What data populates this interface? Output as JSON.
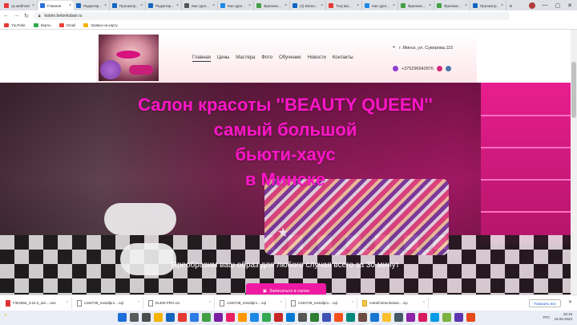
{
  "browser": {
    "tabs": [
      {
        "label": "cp.webhost...",
        "color": "#e53935",
        "active": false
      },
      {
        "label": "Главная",
        "color": "#2f6fd6",
        "active": true
      },
      {
        "label": "Редактир...",
        "color": "#1565c0",
        "active": false
      },
      {
        "label": "Просмотр...",
        "color": "#1565c0",
        "active": false
      },
      {
        "label": "Редактир...",
        "color": "#1565c0",
        "active": false
      },
      {
        "label": "Как сдел...",
        "color": "#555555",
        "active": false
      },
      {
        "label": "Как сдел...",
        "color": "#1e88e5",
        "active": false
      },
      {
        "label": "Фриланс...",
        "color": "#43a047",
        "active": false
      },
      {
        "label": "(3) Катал...",
        "color": "#0a66c2",
        "active": false
      },
      {
        "label": "Tvoj kat...",
        "color": "#e53935",
        "active": false
      },
      {
        "label": "Как сдел...",
        "color": "#1e88e5",
        "active": false
      },
      {
        "label": "Фриланс...",
        "color": "#43a047",
        "active": false
      },
      {
        "label": "Фриланс...",
        "color": "#43a047",
        "active": false
      },
      {
        "label": "Просмотр...",
        "color": "#1565c0",
        "active": false
      }
    ],
    "url": "kobrin.betonkuban.ru",
    "bookmarks": [
      {
        "label": "YouTube",
        "color": "#e53935"
      },
      {
        "label": "Карты",
        "color": "#34a853"
      },
      {
        "label": "Gmail",
        "color": "#ea4335"
      },
      {
        "label": "Заявка на карту",
        "color": "#f4b400"
      }
    ]
  },
  "site": {
    "nav": [
      "Главная",
      "Цены",
      "Мастера",
      "Фото",
      "Обучение",
      "Новости",
      "Контакты"
    ],
    "address": "г. Минск, ул. Суворова,115",
    "phone": "+375296542876",
    "hero": {
      "title_lines": [
        "Салон красоты ''BEAUTY QUEEN''",
        "самый большой",
        "бьюти-хаус",
        "в Минске"
      ],
      "subtitle": "Преобразим ваш образ для любого случая всего за 30 минут",
      "cta": "Записаться в салон"
    },
    "colors": {
      "accent": "#ff16c8",
      "button": "#ee1aa2"
    }
  },
  "downloads": {
    "items": [
      {
        "name": "File258a_3.64.0_win....exe",
        "type": "red"
      },
      {
        "name": "c346738_metallpro....sql",
        "type": "doc"
      },
      {
        "name": "ELEM-PRO.rar",
        "type": "doc"
      },
      {
        "name": "c346738_metallpro....sql",
        "type": "doc"
      },
      {
        "name": "c346738_metallpro....sql",
        "type": "doc"
      },
      {
        "name": "metall-betonkuban....zip",
        "type": "yel"
      }
    ],
    "show_all": "Показать все"
  },
  "taskbar": {
    "lang": "РУС",
    "time": "18:19",
    "date": "19.06.2023"
  }
}
